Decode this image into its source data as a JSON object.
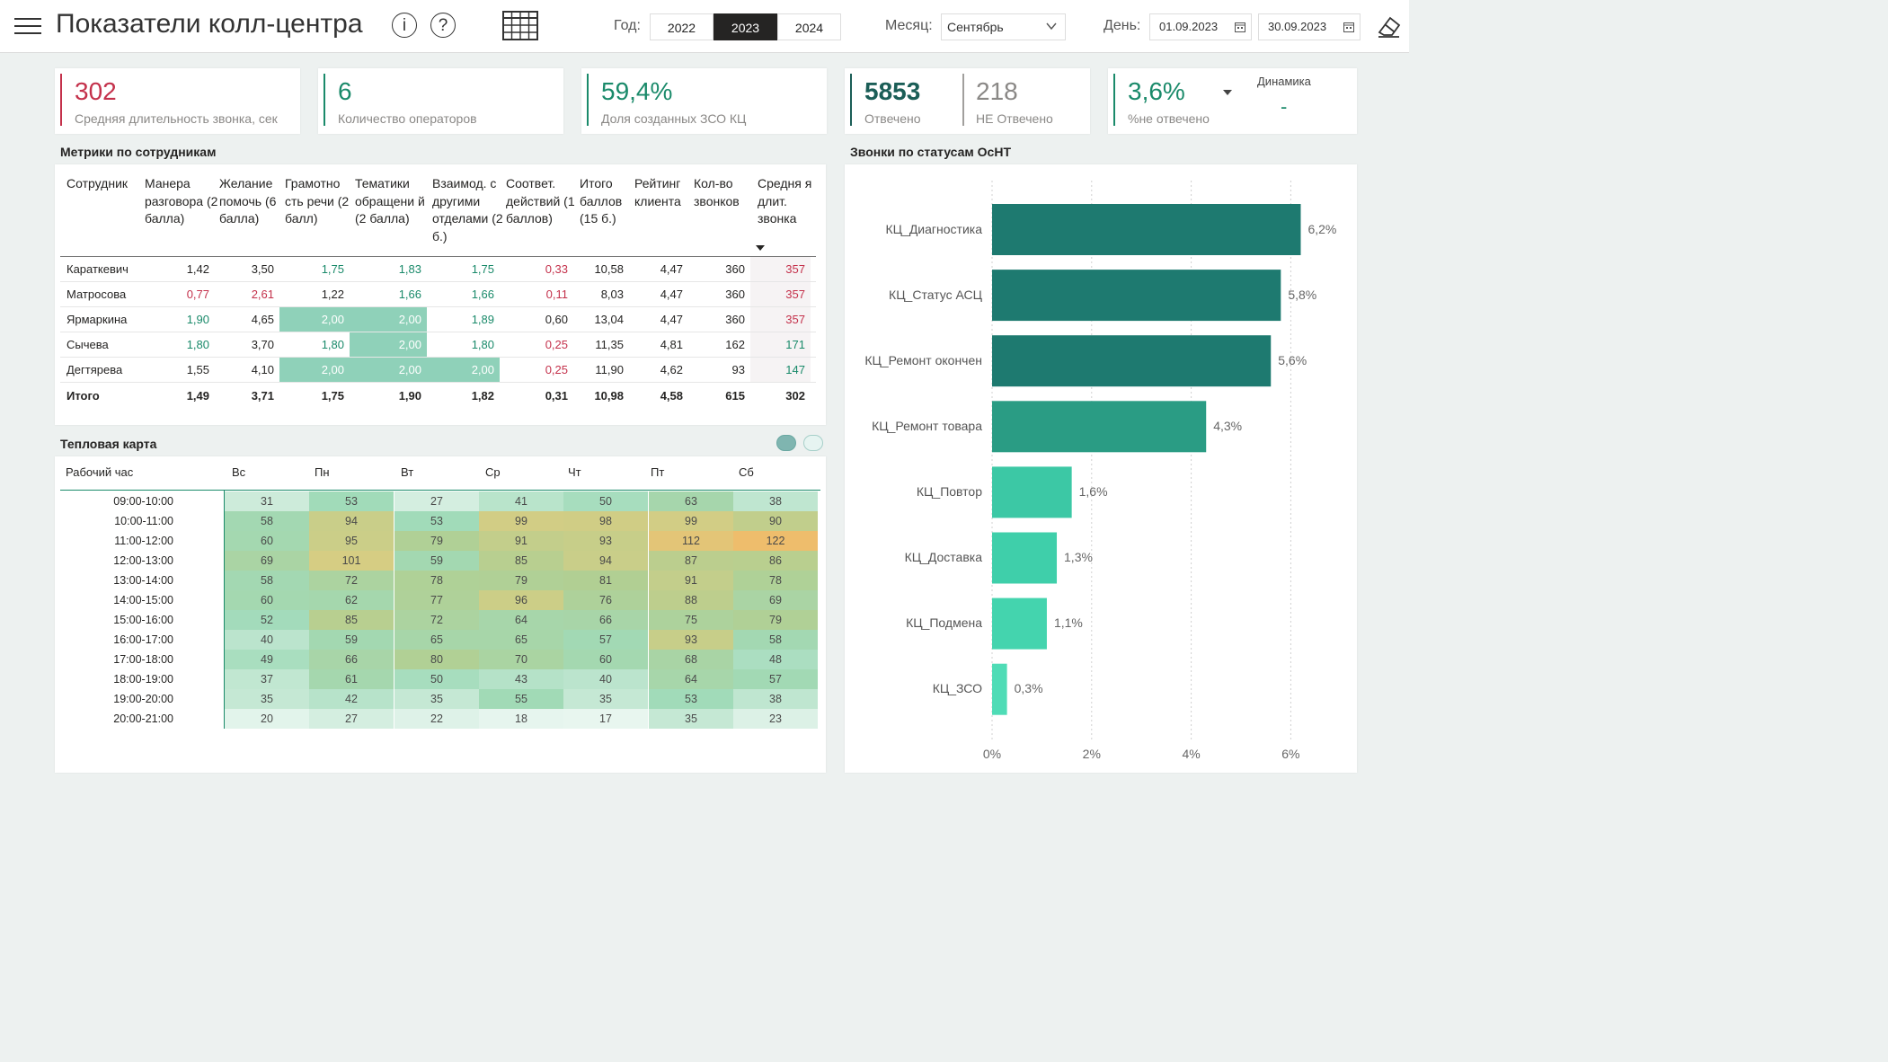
{
  "header": {
    "title": "Показатели колл-центра",
    "info_icon": "i",
    "help_icon": "?",
    "year_label": "Год:",
    "years": [
      "2022",
      "2023",
      "2024"
    ],
    "selected_year": "2023",
    "month_label": "Месяц:",
    "month_value": "Сентябрь",
    "day_label": "День:",
    "date_from": "01.09.2023",
    "date_to": "30.09.2023"
  },
  "kpis": {
    "avg_duration": {
      "value": "302",
      "label": "Средняя длительность звонка, сек",
      "color": "#c4314b"
    },
    "operators": {
      "value": "6",
      "label": "Количество операторов",
      "color": "#1a8a6a"
    },
    "zso_share": {
      "value": "59,4%",
      "label": "Доля созданных ЗСО КЦ",
      "color": "#1a8a6a"
    },
    "answered": {
      "value": "5853",
      "label": "Отвечено"
    },
    "not_answered": {
      "value": "218",
      "label": "НЕ Отвечено"
    },
    "not_answered_pct": {
      "value": "3,6%",
      "label": "%не отвечено",
      "color": "#1a8a6a"
    },
    "dynamics": {
      "label": "Динамика",
      "value": "-"
    }
  },
  "metrics": {
    "title": "Метрики по сотрудникам",
    "headers": [
      "Сотрудник",
      "Манера разговора (2 балла)",
      "Желание помочь (6 балла)",
      "Грамотно сть речи (2 балл)",
      "Тематики обращени й (2 балла)",
      "Взаимод. с другими отделами (2 б.)",
      "Соответ. действий (1 баллов)",
      "Итого баллов (15 б.)",
      "Рейтинг клиента",
      "Кол-во звонков",
      "Средня я длит. звонка"
    ],
    "rows": [
      {
        "name": "Караткевич",
        "values": [
          "1,42",
          "3,50",
          "1,75",
          "1,83",
          "1,75",
          "0,33",
          "10,58",
          "4,47",
          "360",
          "357"
        ]
      },
      {
        "name": "Матросова",
        "values": [
          "0,77",
          "2,61",
          "1,22",
          "1,66",
          "1,66",
          "0,11",
          "8,03",
          "4,47",
          "360",
          "357"
        ]
      },
      {
        "name": "Ярмаркина",
        "values": [
          "1,90",
          "4,65",
          "2,00",
          "2,00",
          "1,89",
          "0,60",
          "13,04",
          "4,47",
          "360",
          "357"
        ]
      },
      {
        "name": "Сычева",
        "values": [
          "1,80",
          "3,70",
          "1,80",
          "2,00",
          "1,80",
          "0,25",
          "11,35",
          "4,81",
          "162",
          "171"
        ]
      },
      {
        "name": "Дегтярева",
        "values": [
          "1,55",
          "4,10",
          "2,00",
          "2,00",
          "2,00",
          "0,25",
          "11,90",
          "4,62",
          "93",
          "147"
        ]
      }
    ],
    "total": {
      "name": "Итого",
      "values": [
        "1,49",
        "3,71",
        "1,75",
        "1,90",
        "1,82",
        "0,31",
        "10,98",
        "4,58",
        "615",
        "302"
      ]
    }
  },
  "heatmap": {
    "title": "Тепловая карта",
    "hour_header": "Рабочий час",
    "days": [
      "Вс",
      "Пн",
      "Вт",
      "Ср",
      "Чт",
      "Пт",
      "Сб"
    ],
    "hours": [
      "09:00-10:00",
      "10:00-11:00",
      "11:00-12:00",
      "12:00-13:00",
      "13:00-14:00",
      "14:00-15:00",
      "15:00-16:00",
      "16:00-17:00",
      "17:00-18:00",
      "18:00-19:00",
      "19:00-20:00",
      "20:00-21:00"
    ],
    "values": [
      [
        31,
        53,
        27,
        41,
        50,
        63,
        38
      ],
      [
        58,
        94,
        53,
        99,
        98,
        99,
        90
      ],
      [
        60,
        95,
        79,
        91,
        93,
        112,
        122
      ],
      [
        69,
        101,
        59,
        85,
        94,
        87,
        86
      ],
      [
        58,
        72,
        78,
        79,
        81,
        91,
        78
      ],
      [
        60,
        62,
        77,
        96,
        76,
        88,
        69
      ],
      [
        52,
        85,
        72,
        64,
        66,
        75,
        79
      ],
      [
        40,
        59,
        65,
        65,
        57,
        93,
        58
      ],
      [
        49,
        66,
        80,
        70,
        60,
        68,
        48
      ],
      [
        37,
        61,
        50,
        43,
        40,
        64,
        57
      ],
      [
        35,
        42,
        35,
        55,
        35,
        53,
        38
      ],
      [
        20,
        27,
        22,
        18,
        17,
        35,
        23
      ]
    ]
  },
  "chart_data": {
    "type": "bar",
    "orientation": "horizontal",
    "title": "Звонки по статусам ОсНТ",
    "categories": [
      "КЦ_Диагностика",
      "КЦ_Статус АСЦ",
      "КЦ_Ремонт окончен",
      "КЦ_Ремонт товара",
      "КЦ_Повтор",
      "КЦ_Доставка",
      "КЦ_Подмена",
      "КЦ_ЗСО"
    ],
    "values": [
      6.2,
      5.8,
      5.6,
      4.3,
      1.6,
      1.3,
      1.1,
      0.3
    ],
    "value_labels": [
      "6,2%",
      "5,8%",
      "5,6%",
      "4,3%",
      "1,6%",
      "1,3%",
      "1,1%",
      "0,3%"
    ],
    "xlim": [
      0,
      6
    ],
    "x_ticks": [
      "0%",
      "2%",
      "4%",
      "6%"
    ],
    "grid": true
  }
}
